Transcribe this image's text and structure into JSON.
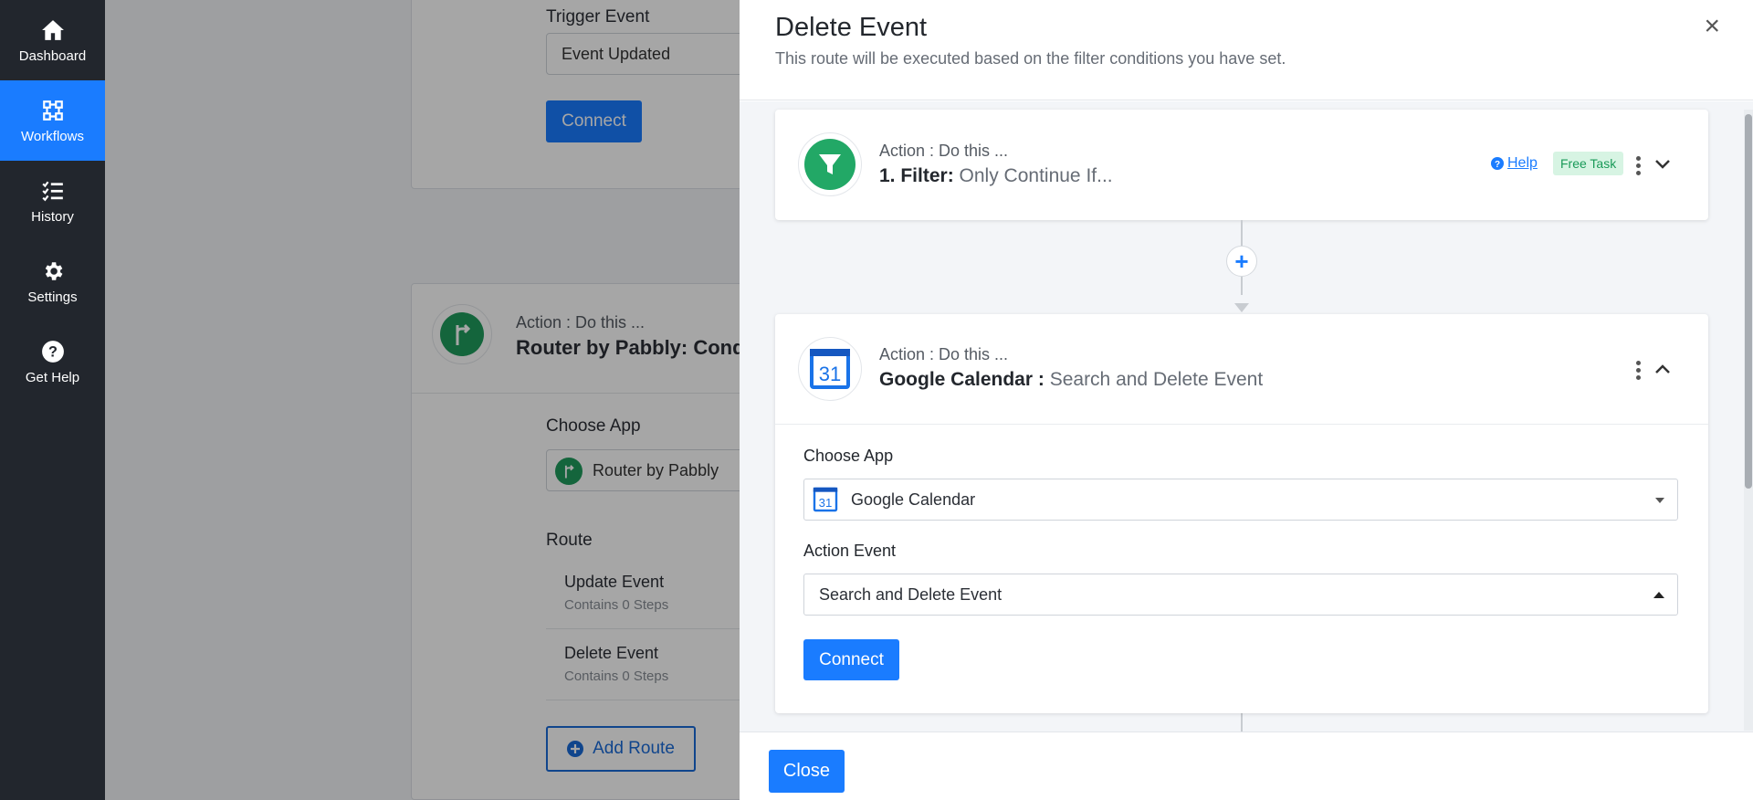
{
  "sidebar": {
    "items": [
      {
        "label": "Dashboard",
        "icon": "home-icon"
      },
      {
        "label": "Workflows",
        "icon": "workflow-icon",
        "active": true
      },
      {
        "label": "History",
        "icon": "list-check-icon"
      },
      {
        "label": "Settings",
        "icon": "gear-icon"
      },
      {
        "label": "Get Help",
        "icon": "question-circle-icon"
      }
    ]
  },
  "background": {
    "trigger_event_label": "Trigger Event",
    "trigger_event_value": "Event Updated",
    "connect_label": "Connect",
    "router_pre": "Action : Do this ...",
    "router_title": "Router by Pabbly: Cond",
    "choose_app_label": "Choose App",
    "choose_app_value": "Router by Pabbly",
    "route_label": "Route",
    "routes": [
      {
        "name": "Update Event",
        "steps": "Contains 0 Steps"
      },
      {
        "name": "Delete Event",
        "steps": "Contains 0 Steps"
      }
    ],
    "add_route_label": "Add Route"
  },
  "modal": {
    "title": "Delete Event",
    "subtitle": "This route will be executed based on the filter conditions you have set.",
    "close_x": "×",
    "filter_step": {
      "pre": "Action : Do this ...",
      "title": "1. Filter:",
      "subtitle": "Only Continue If...",
      "help_label": "Help",
      "badge": "Free Task"
    },
    "calendar_step": {
      "pre": "Action : Do this ...",
      "title": "Google Calendar :",
      "subtitle": "Search and Delete Event",
      "icon_text": "31",
      "choose_app_label": "Choose App",
      "choose_app_value": "Google Calendar",
      "action_event_label": "Action Event",
      "action_event_value": "Search and Delete Event",
      "connect_label": "Connect"
    },
    "plus_label": "+",
    "close_button": "Close"
  },
  "colors": {
    "accent": "#1a7cff",
    "sidebar_bg": "#22262d",
    "filter_green": "#22a866",
    "router_green": "#1f9b5c",
    "badge_bg": "#d7f4e3",
    "badge_text": "#1a9a58"
  }
}
